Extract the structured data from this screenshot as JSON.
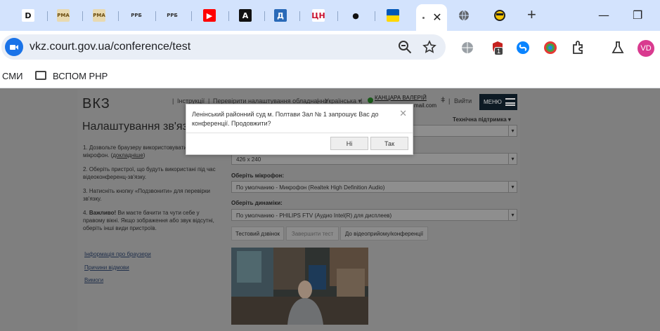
{
  "browser": {
    "tabs": [
      {
        "name": "tab-d",
        "icon": "letter-d-icon",
        "glyph": "D",
        "bg": "#ffffff",
        "fg": "#111111"
      },
      {
        "name": "tab-rma-1",
        "icon": "rma-icon",
        "glyph": "РМА",
        "bg": "#e8d9b0",
        "fg": "#6b4d10"
      },
      {
        "name": "tab-rma-2",
        "icon": "rma-icon",
        "glyph": "РМА",
        "bg": "#e8d9b0",
        "fg": "#6b4d10"
      },
      {
        "name": "tab-rrb-1",
        "icon": "rrb-icon",
        "glyph": "РРБ",
        "bg": "#d3e3fd",
        "fg": "#333333"
      },
      {
        "name": "tab-rrb-2",
        "icon": "rrb-icon",
        "glyph": "РРБ",
        "bg": "#d3e3fd",
        "fg": "#333333"
      },
      {
        "name": "tab-youtube",
        "icon": "youtube-icon",
        "glyph": "▶",
        "bg": "#ff0000",
        "fg": "#ffffff"
      },
      {
        "name": "tab-a",
        "icon": "letter-a-icon",
        "glyph": "A",
        "bg": "#111111",
        "fg": "#ffffff"
      },
      {
        "name": "tab-d-blue",
        "icon": "letter-d-blue-icon",
        "glyph": "Д",
        "bg": "#2a6ab8",
        "fg": "#ffffff"
      },
      {
        "name": "tab-cn",
        "icon": "cn-icon",
        "glyph": "ЦН",
        "bg": "#ffffff",
        "fg": "#c8102e"
      },
      {
        "name": "tab-spy",
        "icon": "incognito-icon",
        "glyph": "●",
        "bg": "#d3e3fd",
        "fg": "#111111"
      },
      {
        "name": "tab-ua-flag",
        "icon": "ukraine-flag-icon",
        "glyph": "",
        "bg": "#0057b7",
        "fg": "#ffd700"
      }
    ],
    "url": "vkz.court.gov.ua/conference/test",
    "extension_badge": "1",
    "profile_initials": "VD",
    "bookmarks": {
      "smi": "СМИ",
      "folder": "ВСПОМ PHP"
    }
  },
  "site": {
    "logo": "ВКЗ",
    "nav": {
      "instructions": "Інструкції",
      "check_settings": "Перевірити налаштування обладнання",
      "language": "Українська ▾",
      "username": "КАНЦАРА ВАЛЕРІЙ",
      "email": "mail.com",
      "exit": "Вийти",
      "menu": "МЕНЮ"
    },
    "support": "Технічна підтримка ▾",
    "title": "Налаштування зв'язку",
    "steps": {
      "s1_a": "Дозвольте браузеру використовувати камеру та мікрофон. (",
      "s1_link": "докладніше",
      "s1_b": ")",
      "s2": "Оберіть пристрої, що будуть використані під час відеоконференц-зв'язку.",
      "s3": "Натисніть кнопку «Подзвонити» для перевірки зв'язку.",
      "s4_bold": "Важливо!",
      "s4_rest": " Ви маєте бачити та чути себе у правому вікні. Якщо зображення або звук відсутні, оберіть інші види пристроїв."
    },
    "left_links": {
      "browser_info": "Інформація про браузери",
      "refusal_reasons": "Причини відмови",
      "requirements": "Вимоги"
    },
    "resolution_value": "426 x 240",
    "microphone_label": "Оберіть мікрофон:",
    "microphone_value": "По умолчанию - Микрофон (Realtek High Definition Audio)",
    "speakers_label": "Оберіть динаміки:",
    "speakers_value": "По умолчанию - PHILIPS FTV (Аудио Intel(R) для дисплеев)",
    "buttons": {
      "test_call": "Тестовий дзвінок",
      "finish_test": "Завершити тест",
      "to_conference": "До відеоприйому/конференції"
    }
  },
  "modal": {
    "message": "Ленінський районний суд м. Полтави Зал № 1 запрошує Вас до конференції. Продовжити?",
    "no": "Ні",
    "yes": "Так"
  }
}
